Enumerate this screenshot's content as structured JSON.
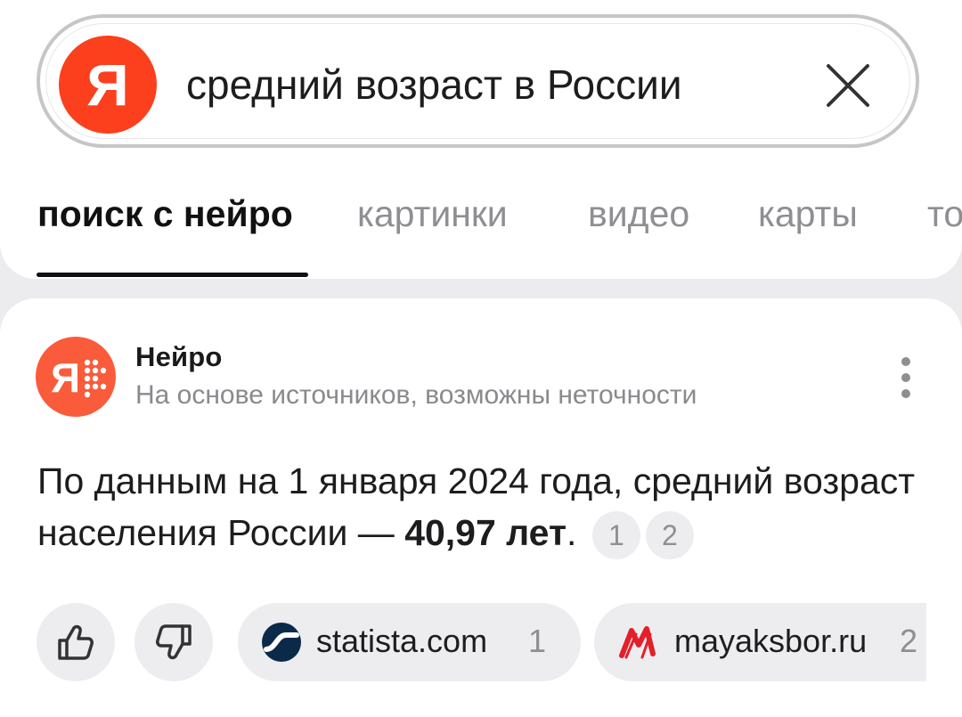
{
  "search": {
    "logo_letter": "Я",
    "query": "средний возраст в России"
  },
  "tabs": [
    {
      "label": "поиск с нейро",
      "active": true
    },
    {
      "label": "картинки",
      "active": false
    },
    {
      "label": "видео",
      "active": false
    },
    {
      "label": "карты",
      "active": false
    },
    {
      "label": "то",
      "active": false
    }
  ],
  "neuro": {
    "title": "Нейро",
    "subtitle": "На основе источников, возможны неточности",
    "answer_text": "По данным на 1 января 2024 года, средний возраст населения России — ",
    "answer_bold": "40,97 лет",
    "answer_end": ".",
    "refs": [
      "1",
      "2"
    ]
  },
  "sources": [
    {
      "name": "statista.com",
      "num": "1"
    },
    {
      "name": "mayaksbor.ru",
      "num": "2"
    }
  ],
  "colors": {
    "yandex_red": "#fc3f1d",
    "neuro_orange": "#fa5b3b",
    "background": "#ececef"
  },
  "icons": {
    "search_clear": "close-icon",
    "like": "thumbs-up-icon",
    "dislike": "thumbs-down-icon",
    "menu": "more-vertical-icon"
  }
}
